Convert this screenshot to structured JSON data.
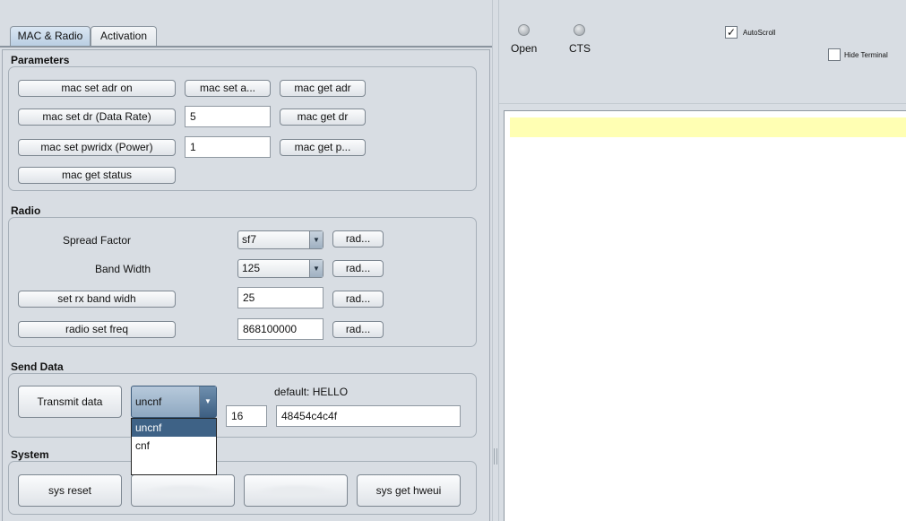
{
  "tabs": [
    {
      "label": "MAC & Radio",
      "active": true
    },
    {
      "label": "Activation",
      "active": false
    }
  ],
  "parameters": {
    "title": "Parameters",
    "mac_set_adr": "mac set adr on",
    "mac_set_a": "mac set a...",
    "mac_get_adr": "mac get adr",
    "mac_set_dr": "mac set dr (Data Rate)",
    "dr_value": "5",
    "mac_get_dr": "mac get dr",
    "mac_set_pwridx": "mac set pwridx (Power)",
    "pwridx_value": "1",
    "mac_get_p": "mac get p...",
    "mac_get_status": "mac get status"
  },
  "radio": {
    "title": "Radio",
    "spread_factor_label": "Spread Factor",
    "spread_factor_value": "sf7",
    "spread_factor_button": "rad...",
    "bandwidth_label": "Band Width",
    "bandwidth_value": "125",
    "bandwidth_button": "rad...",
    "set_rx_bw": "set rx band widh",
    "rx_bw_value": "25",
    "rx_bw_button": "rad...",
    "set_freq": "radio set freq",
    "freq_value": "868100000",
    "freq_button": "rad..."
  },
  "send_data": {
    "title": "Send Data",
    "transmit_button": "Transmit data",
    "mode_value": "uncnf",
    "default_label": "default: HELLO",
    "port_value": "16",
    "payload_value": "48454c4c4f",
    "dropdown_options": [
      "uncnf",
      "cnf"
    ]
  },
  "system": {
    "title": "System",
    "sys_reset": "sys reset",
    "sys_get_hweui": "sys get hweui"
  },
  "status": {
    "open_label": "Open",
    "cts_label": "CTS",
    "autoscroll_label": "AutoScroll",
    "autoscroll_checked": true,
    "hide_terminal_label": "Hide Terminal",
    "hide_terminal_checked": false
  },
  "icons": {
    "dropdown_arrow": "▼",
    "checkmark": "✓"
  }
}
